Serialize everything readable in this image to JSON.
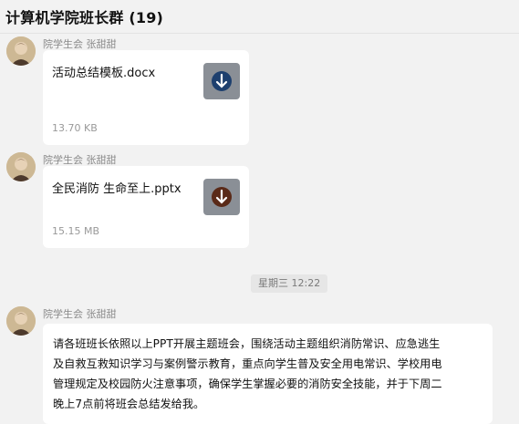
{
  "header": {
    "title": "计算机学院班长群 (19)"
  },
  "messages": [
    {
      "sender": "院学生会 张甜甜",
      "file": {
        "name": "活动总结模板.docx",
        "size": "13.70 KB",
        "icon": "word-doc-icon",
        "color": "#1d3f6e"
      }
    },
    {
      "sender": "院学生会 张甜甜",
      "file": {
        "name": "全民消防 生命至上.pptx",
        "size": "15.15 MB",
        "icon": "ppt-icon",
        "color": "#5a2a18"
      }
    },
    {
      "timestamp": "星期三 12:22"
    },
    {
      "sender": "院学生会 张甜甜",
      "text": "请各班班长依照以上PPT开展主题班会，围绕活动主题组织消防常识、应急逃生\n及自救互救知识学习与案例警示教育，重点向学生普及安全用电常识、学校用电\n管理规定及校园防火注意事项，确保学生掌握必要的消防安全技能，并于下周二\n晚上7点前将班会总结发给我。"
    }
  ]
}
